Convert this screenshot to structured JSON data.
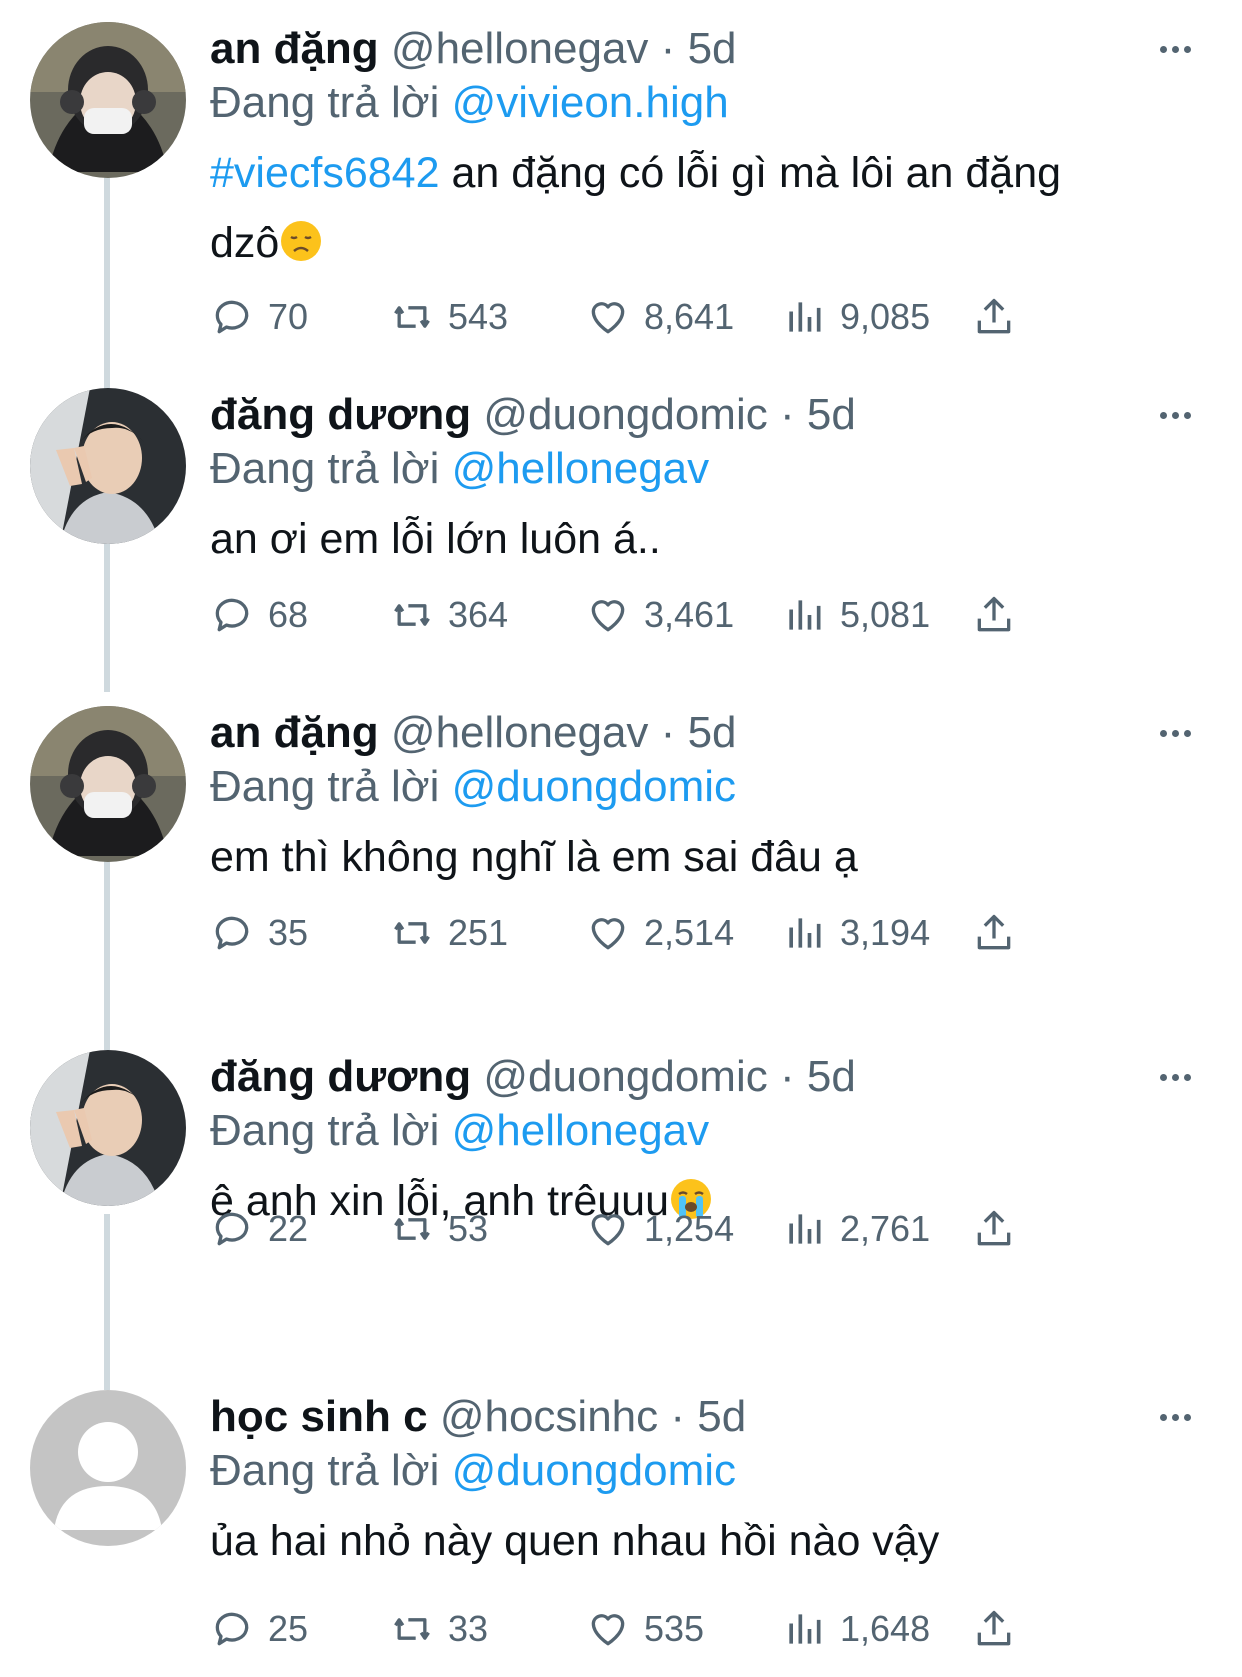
{
  "tweets": [
    {
      "name": "an đặng",
      "handle": "@hellonegav",
      "time": "5d",
      "reply_prefix": "Đang trả lời",
      "reply_to": "@vivieon.high",
      "hashtag": "#viecfs6842",
      "text": " an đặng có lỗi gì mà lôi an đặng",
      "text2": "dzô",
      "emoji": "disappointed-face",
      "replies": "70",
      "retweets": "543",
      "likes": "8,641",
      "views": "9,085",
      "avatar": "photo-masked-hood"
    },
    {
      "name": "đăng dương",
      "handle": "@duongdomic",
      "time": "5d",
      "reply_prefix": "Đang trả lời",
      "reply_to": "@hellonegav",
      "text": "an ơi em lỗi lớn luôn á..",
      "replies": "68",
      "retweets": "364",
      "likes": "3,461",
      "views": "5,081",
      "avatar": "photo-peace-sign"
    },
    {
      "name": "an đặng",
      "handle": "@hellonegav",
      "time": "5d",
      "reply_prefix": "Đang trả lời",
      "reply_to": "@duongdomic",
      "text": "em thì không nghĩ là em sai đâu ạ",
      "replies": "35",
      "retweets": "251",
      "likes": "2,514",
      "views": "3,194",
      "avatar": "photo-masked-hood"
    },
    {
      "name": "đăng dương",
      "handle": "@duongdomic",
      "time": "5d",
      "reply_prefix": "Đang trả lời",
      "reply_to": "@hellonegav",
      "text": "ê anh xin lỗi, anh trêuuu",
      "emoji": "loudly-crying-face",
      "replies": "22",
      "retweets": "53",
      "likes": "1,254",
      "views": "2,761",
      "avatar": "photo-peace-sign"
    },
    {
      "name": "học sinh c",
      "handle": "@hocsinhc",
      "time": "5d",
      "reply_prefix": "Đang trả lời",
      "reply_to": "@duongdomic",
      "text": "ủa hai nhỏ này quen nhau hồi nào vậy",
      "replies": "25",
      "retweets": "33",
      "likes": "535",
      "views": "1,648",
      "avatar": "default-avatar"
    }
  ],
  "dot_separator": "·",
  "colors": {
    "accent": "#1d9bf0",
    "secondary_text": "#536471",
    "primary_text": "#0f1419",
    "thread_line": "#cfd9de"
  }
}
